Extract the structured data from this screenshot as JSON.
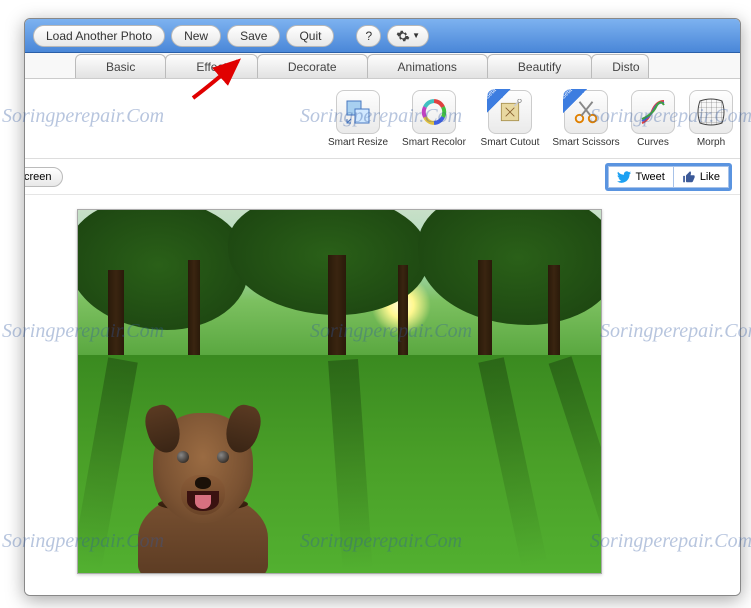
{
  "toolbar": {
    "load_label": "Load Another Photo",
    "new_label": "New",
    "save_label": "Save",
    "quit_label": "Quit",
    "help_label": "?",
    "gear_label": "⚙"
  },
  "tabs": [
    {
      "label": "Basic"
    },
    {
      "label": "Effect"
    },
    {
      "label": "Decorate"
    },
    {
      "label": "Animations"
    },
    {
      "label": "Beautify"
    },
    {
      "label": "Disto"
    }
  ],
  "tools": [
    {
      "label": "Smart Resize",
      "icon": "resize"
    },
    {
      "label": "Smart Recolor",
      "icon": "recolor"
    },
    {
      "label": "Smart Cutout",
      "icon": "cutout",
      "beta": true
    },
    {
      "label": "Smart Scissors",
      "icon": "scissors",
      "beta": true
    },
    {
      "label": "Curves",
      "icon": "curves"
    },
    {
      "label": "Morph",
      "icon": "morph"
    }
  ],
  "subbar": {
    "screen_label": "creen"
  },
  "social": {
    "tweet_label": "Tweet",
    "like_label": "Like"
  },
  "watermark_text": "Soringperepair.Com",
  "canvas": {
    "subject": "dog-on-grass-park"
  }
}
